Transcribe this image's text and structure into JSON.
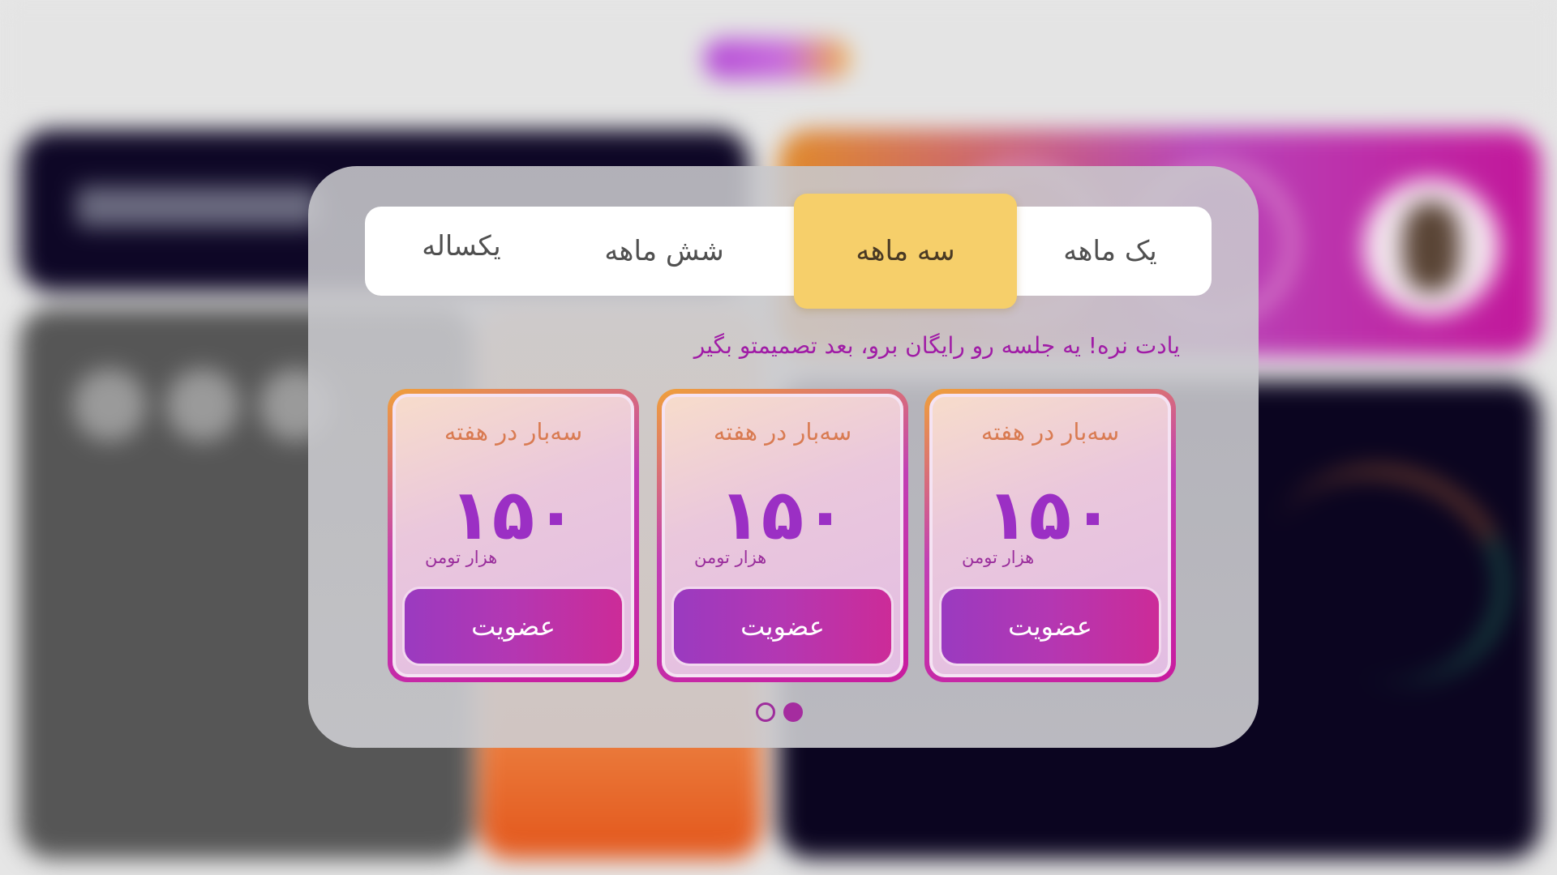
{
  "tabs": [
    {
      "label": "یک ماهه",
      "active": false
    },
    {
      "label": "سه ماهه",
      "active": true
    },
    {
      "label": "شش ماهه",
      "active": false
    },
    {
      "label": "یکساله",
      "active": false
    }
  ],
  "notice": "یادت نره! یه جلسه رو رایگان برو، بعد تصمیمتو بگیر",
  "plans": [
    {
      "frequency": "سه‌بار در هفته",
      "price": "۱۵۰",
      "unit": "هزار تومن",
      "button": "عضویت"
    },
    {
      "frequency": "سه‌بار در هفته",
      "price": "۱۵۰",
      "unit": "هزار تومن",
      "button": "عضویت"
    },
    {
      "frequency": "سه‌بار در هفته",
      "price": "۱۵۰",
      "unit": "هزار تومن",
      "button": "عضویت"
    }
  ],
  "pager": {
    "count": 2,
    "active_index": 1
  },
  "colors": {
    "active_tab": "#f6cf6a",
    "accent_purple": "#9b2fc4",
    "accent_magenta": "#c81a9e",
    "frequency_text": "#d97b52"
  }
}
